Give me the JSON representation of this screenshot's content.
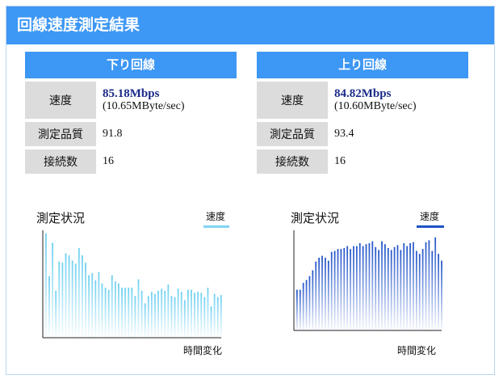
{
  "header": {
    "title": "回線速度測定結果"
  },
  "download": {
    "title": "下り回線",
    "speed_label": "速度",
    "speed_main": "85.18Mbps",
    "speed_sub": "(10.65MByte/sec)",
    "quality_label": "測定品質",
    "quality_value": "91.8",
    "connections_label": "接続数",
    "connections_value": "16"
  },
  "upload": {
    "title": "上り回線",
    "speed_label": "速度",
    "speed_main": "84.82Mbps",
    "speed_sub": "(10.60MByte/sec)",
    "quality_label": "測定品質",
    "quality_value": "93.4",
    "connections_label": "接続数",
    "connections_value": "16"
  },
  "colors": {
    "header_bg": "#3d97f4",
    "download_series": "#7fd4f3",
    "upload_series": "#1f52c8"
  },
  "chart_data": [
    {
      "type": "bar",
      "title": "測定状況",
      "xlabel": "時間変化",
      "ylabel": "",
      "legend": "top-right",
      "series": [
        {
          "name": "速度",
          "values": [
            1.0,
            0.59,
            0.91,
            0.45,
            0.73,
            0.72,
            0.81,
            0.79,
            0.74,
            0.71,
            0.86,
            0.79,
            0.72,
            0.6,
            0.62,
            0.55,
            0.63,
            0.52,
            0.48,
            0.46,
            0.6,
            0.54,
            0.52,
            0.48,
            0.48,
            0.48,
            0.48,
            0.4,
            0.56,
            0.45,
            0.33,
            0.4,
            0.44,
            0.42,
            0.45,
            0.47,
            0.45,
            0.51,
            0.4,
            0.39,
            0.47,
            0.44,
            0.36,
            0.46,
            0.46,
            0.43,
            0.44,
            0.43,
            0.39,
            0.48,
            0.3,
            0.42,
            0.39,
            0.41
          ]
        }
      ],
      "ylim": [
        0,
        1
      ]
    },
    {
      "type": "bar",
      "title": "測定状況",
      "xlabel": "時間変化",
      "ylabel": "",
      "legend": "top-right",
      "series": [
        {
          "name": "速度",
          "values": [
            0.42,
            0.42,
            0.49,
            0.52,
            0.56,
            0.62,
            0.71,
            0.75,
            0.77,
            0.75,
            0.72,
            0.81,
            0.82,
            0.84,
            0.84,
            0.85,
            0.87,
            0.84,
            0.87,
            0.87,
            0.9,
            0.87,
            0.89,
            0.9,
            0.92,
            0.86,
            0.83,
            0.92,
            0.89,
            0.85,
            0.83,
            0.86,
            0.88,
            0.83,
            0.9,
            0.87,
            0.9,
            0.91,
            0.82,
            0.79,
            0.84,
            0.91,
            0.93,
            0.82,
            0.96,
            0.79,
            0.72
          ]
        }
      ],
      "ylim": [
        0,
        1
      ]
    }
  ]
}
